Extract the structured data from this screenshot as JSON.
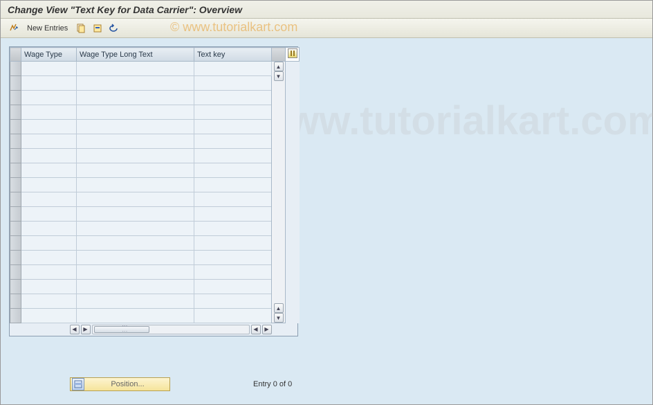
{
  "title": "Change View \"Text Key for Data Carrier\": Overview",
  "toolbar": {
    "new_entries_label": "New Entries"
  },
  "table": {
    "col1": "Wage Type",
    "col2": "Wage Type Long Text",
    "col3": "Text key"
  },
  "footer": {
    "position_label": "Position...",
    "entry_text": "Entry 0 of 0"
  },
  "watermark": "© www.tutorialkart.com",
  "watermark_bg": "www.tutorialkart.com"
}
